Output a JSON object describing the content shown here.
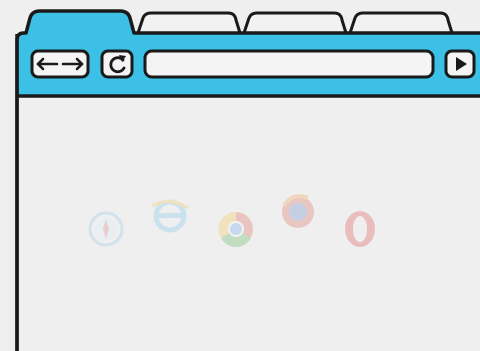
{
  "colors": {
    "background": "#efefef",
    "toolbar": "#3cc0e6",
    "outline": "#1a1a1a",
    "tab_fill": "#f2f2f2",
    "address_bar": "#f4f4f4"
  },
  "toolbar": {
    "back_forward_icon": "back-forward-arrows-icon",
    "reload_icon": "reload-icon",
    "go_icon": "play-triangle-icon",
    "address_value": ""
  },
  "tabs": [
    {
      "name": "active-tab",
      "active": true
    },
    {
      "name": "tab-2",
      "active": false
    },
    {
      "name": "tab-3",
      "active": false
    },
    {
      "name": "tab-4",
      "active": false
    }
  ],
  "faded_logos": [
    "safari-logo-icon",
    "internet-explorer-logo-icon",
    "chrome-logo-icon",
    "firefox-logo-icon",
    "opera-logo-icon"
  ]
}
